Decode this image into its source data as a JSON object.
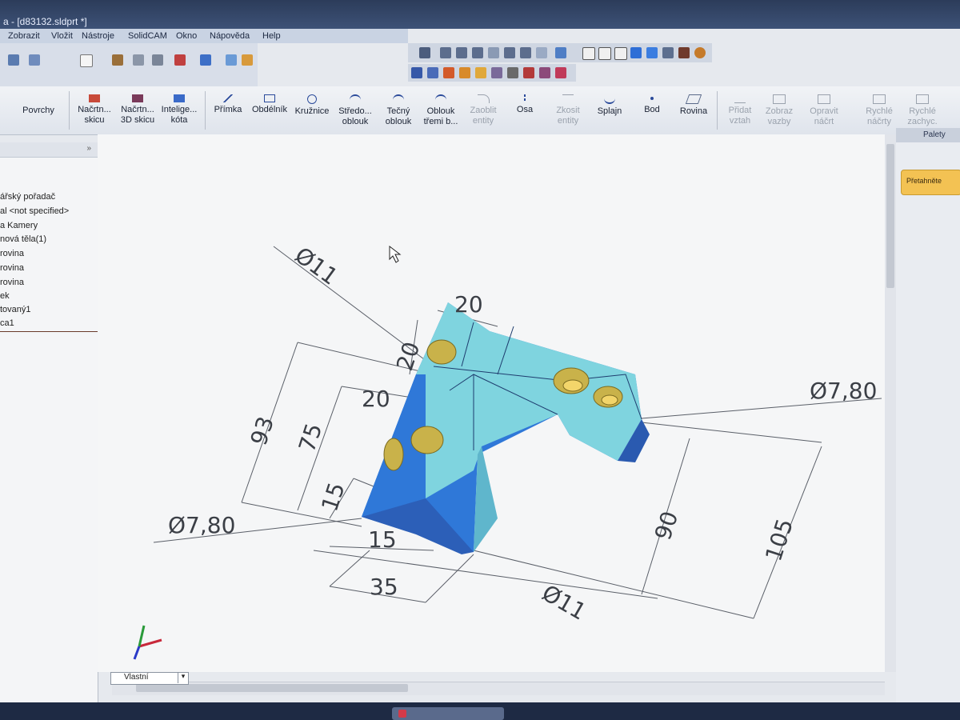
{
  "window": {
    "title": "a - [d83132.sldprt *]"
  },
  "menu": {
    "items": [
      "Zobrazit",
      "Vložit",
      "Nástroje",
      "SolidCAM",
      "Okno",
      "Nápověda",
      "Help"
    ]
  },
  "ribbon": {
    "buttons": [
      {
        "label": "Povrchy"
      },
      {
        "label": "Načrtn... skicu"
      },
      {
        "label": "Načrtn... 3D skicu"
      },
      {
        "label": "Intelige... kóta"
      },
      {
        "label": "Přímka"
      },
      {
        "label": "Obdélník"
      },
      {
        "label": "Kružnice"
      },
      {
        "label": "Středo... oblouk"
      },
      {
        "label": "Tečný oblouk"
      },
      {
        "label": "Oblouk třemi b..."
      },
      {
        "label": "Zaoblit entity"
      },
      {
        "label": "Osa"
      },
      {
        "label": "Zkosit entity"
      },
      {
        "label": "Splajn"
      },
      {
        "label": "Bod"
      },
      {
        "label": "Rovina"
      },
      {
        "label": "Přidat vztah"
      },
      {
        "label": "Zobraz vazby"
      },
      {
        "label": "Opravit náčrt"
      },
      {
        "label": "Rychlé náčrty"
      },
      {
        "label": "Rychlé zachyc."
      }
    ]
  },
  "tree": {
    "items": [
      "ářský pořadač",
      "al <not specified>",
      "a Kamery",
      "nová těla(1)",
      "rovina",
      "rovina",
      "rovina",
      "ek",
      "tovaný1",
      "ca1"
    ]
  },
  "right_panel": {
    "tab": "Palety",
    "button": "Přetahněte"
  },
  "view": {
    "selector": "Vlastní"
  },
  "dimensions": {
    "d_top_hole": "Ø11",
    "d_top": "20",
    "d_vert_20": "20",
    "d_20b": "20",
    "d_93": "93",
    "d_75": "75",
    "d_15a": "15",
    "d_15b": "15",
    "d_35": "35",
    "d_left_hole": "Ø7,80",
    "d_right_hole": "Ø7,80",
    "d_90": "90",
    "d_105": "105",
    "d_bottom_hole": "Ø11"
  },
  "colors": {
    "model_top": "#7fd4df",
    "model_side": "#2f78d8",
    "model_dark": "#2c5fb8",
    "hole": "#c9b24a",
    "accent": "#f3c253"
  }
}
